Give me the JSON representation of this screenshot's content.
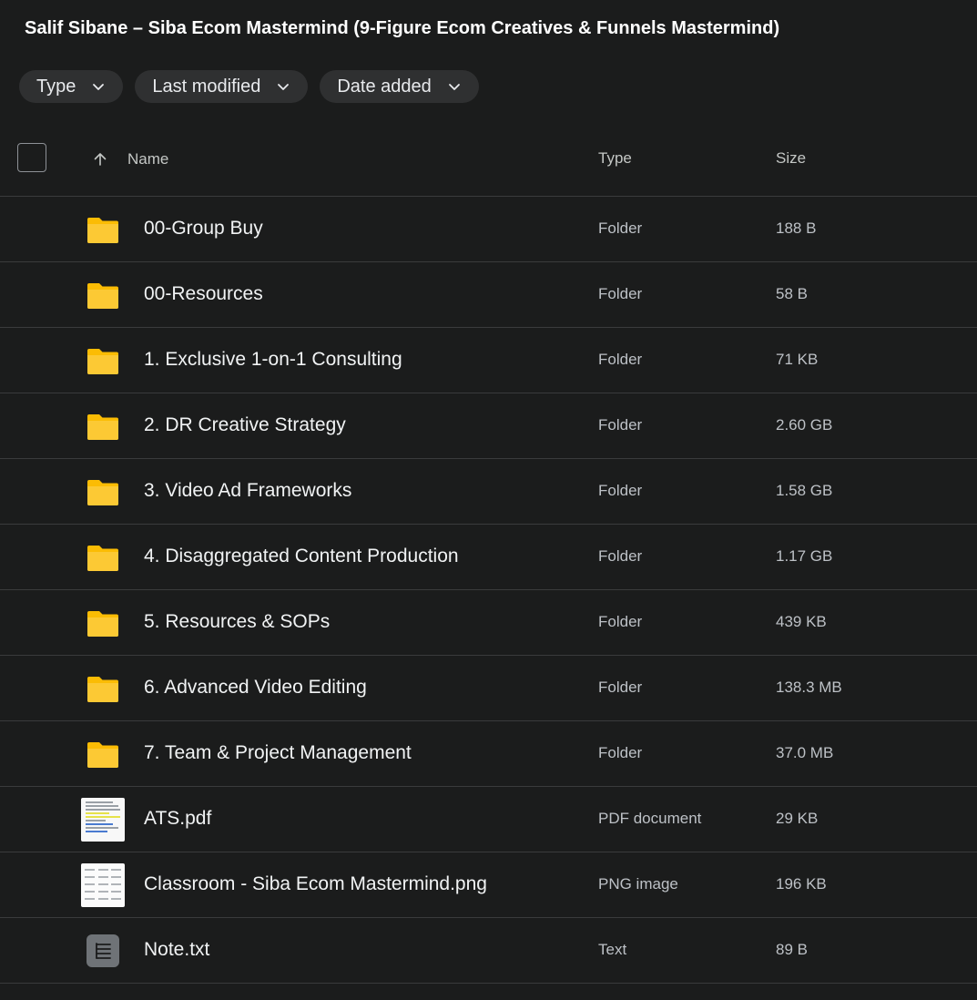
{
  "title": "Salif Sibane – Siba Ecom Mastermind (9-Figure Ecom Creatives & Funnels Mastermind)",
  "filters": [
    {
      "label": "Type",
      "icon": "chevron-down-icon"
    },
    {
      "label": "Last modified",
      "icon": "chevron-down-icon"
    },
    {
      "label": "Date added",
      "icon": "chevron-down-icon"
    }
  ],
  "columns": {
    "name": "Name",
    "type": "Type",
    "size": "Size",
    "sort_icon": "arrow-up-icon"
  },
  "colors": {
    "background": "#1b1c1c",
    "folder": "#fbbc04",
    "divider": "#3a3b3c"
  },
  "files": [
    {
      "name": "00-Group Buy",
      "type": "Folder",
      "size": "188 B",
      "icon": "folder-icon"
    },
    {
      "name": "00-Resources",
      "type": "Folder",
      "size": "58 B",
      "icon": "folder-icon"
    },
    {
      "name": "1. Exclusive 1-on-1 Consulting",
      "type": "Folder",
      "size": "71 KB",
      "icon": "folder-icon"
    },
    {
      "name": "2. DR Creative Strategy",
      "type": "Folder",
      "size": "2.60 GB",
      "icon": "folder-icon"
    },
    {
      "name": "3. Video Ad Frameworks",
      "type": "Folder",
      "size": "1.58 GB",
      "icon": "folder-icon"
    },
    {
      "name": "4. Disaggregated Content Production",
      "type": "Folder",
      "size": "1.17 GB",
      "icon": "folder-icon"
    },
    {
      "name": "5. Resources & SOPs",
      "type": "Folder",
      "size": "439 KB",
      "icon": "folder-icon"
    },
    {
      "name": "6. Advanced Video Editing",
      "type": "Folder",
      "size": "138.3 MB",
      "icon": "folder-icon"
    },
    {
      "name": "7. Team & Project Management",
      "type": "Folder",
      "size": "37.0 MB",
      "icon": "folder-icon"
    },
    {
      "name": "ATS.pdf",
      "type": "PDF document",
      "size": "29 KB",
      "icon": "pdf-thumbnail-icon"
    },
    {
      "name": "Classroom - Siba Ecom Mastermind.png",
      "type": "PNG image",
      "size": "196 KB",
      "icon": "png-thumbnail-icon"
    },
    {
      "name": "Note.txt",
      "type": "Text",
      "size": "89 B",
      "icon": "text-file-icon"
    }
  ]
}
